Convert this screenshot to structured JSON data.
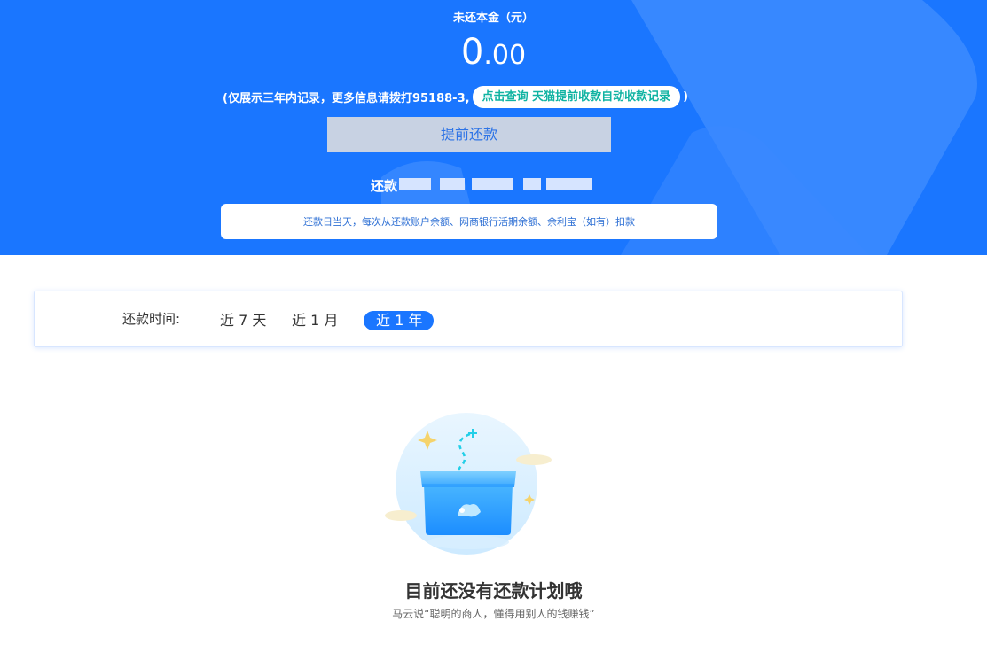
{
  "header": {
    "title": "未还本金（元）",
    "amount_int": "0",
    "amount_dec": ".00",
    "notice_text": "(仅展示三年内记录，更多信息请拨打95188-3,",
    "notice_link": "点击查询 天猫提前收款自动收款记录",
    "notice_close": ")",
    "prepay_button": "提前还款",
    "repay_label": "还款",
    "info_text": "还款日当天，每次从还款账户余额、网商银行活期余额、余利宝（如有）扣款"
  },
  "filter": {
    "label": "还款时间:",
    "options": [
      "近 7 天",
      "近 1 月",
      "近 1 年"
    ],
    "active_index": 2
  },
  "empty_state": {
    "title": "目前还没有还款计划哦",
    "subtitle": "马云说“聪明的商人，懂得用别人的钱赚钱”"
  },
  "colors": {
    "primary": "#1a76ff",
    "button_bg": "#c8d2e3",
    "link_text": "#10b3a2"
  },
  "icons": {
    "illustration": "empty-box-illustration"
  }
}
